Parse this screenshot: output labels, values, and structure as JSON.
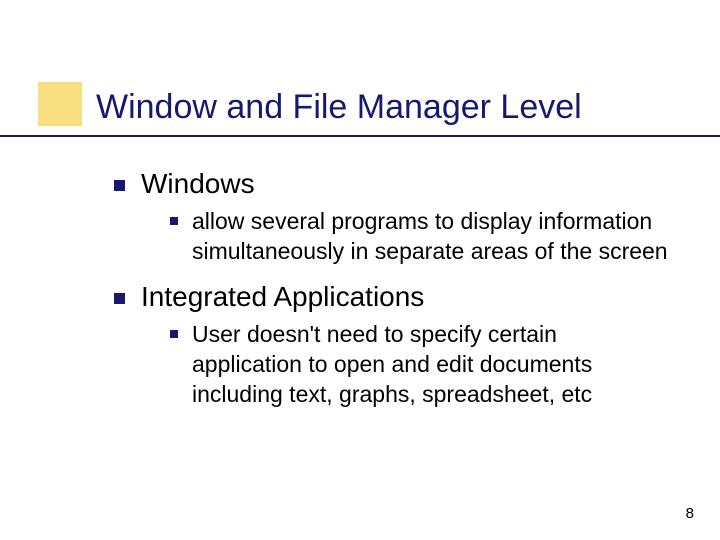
{
  "title": "Window and File Manager Level",
  "items": [
    {
      "label": "Windows",
      "children": [
        {
          "text": "allow several programs to display information simultaneously in separate areas of the screen"
        }
      ]
    },
    {
      "label": "Integrated Applications",
      "children": [
        {
          "text": "User doesn't need to specify certain application to open and edit documents including text, graphs, spreadsheet, etc"
        }
      ]
    }
  ],
  "page_number": "8"
}
